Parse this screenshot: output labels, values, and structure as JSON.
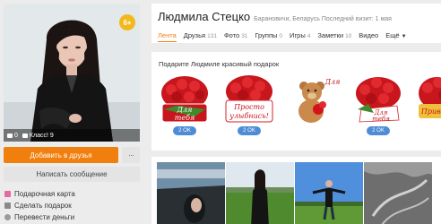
{
  "profile": {
    "name": "Людмила Стецко",
    "meta": "Барановичи, Беларусь  Последний визит: 1 мая",
    "age_badge": "6+"
  },
  "avatar": {
    "comments_count": "0",
    "klass_label": "Класс! 9"
  },
  "actions": {
    "add_friend": "Добавить в друзья",
    "more": "···",
    "write_message": "Написать сообщение"
  },
  "side_links": [
    {
      "label": "Подарочная карта",
      "icon": "gift-card-icon"
    },
    {
      "label": "Сделать подарок",
      "icon": "gift-icon"
    },
    {
      "label": "Перевести деньги",
      "icon": "money-icon"
    }
  ],
  "tabs": [
    {
      "label": "Лента",
      "count": ""
    },
    {
      "label": "Друзья",
      "count": "131"
    },
    {
      "label": "Фото",
      "count": "31"
    },
    {
      "label": "Группы",
      "count": "0"
    },
    {
      "label": "Игры",
      "count": "4"
    },
    {
      "label": "Заметки",
      "count": "10"
    },
    {
      "label": "Видео",
      "count": ""
    },
    {
      "label": "Ещё",
      "count": ""
    }
  ],
  "gifts": {
    "title": "Подарите Людмиле красивый подарок",
    "items": [
      {
        "price": "2 OK",
        "caption_lines": [
          "Для",
          "тебя"
        ]
      },
      {
        "price": "2 OK",
        "caption_lines": [
          "Просто",
          "улыбнись!"
        ]
      },
      {
        "price": "",
        "caption_lines": [
          "Для"
        ]
      },
      {
        "price": "2 OK",
        "caption_lines": [
          "Для",
          "тебя"
        ]
      },
      {
        "price": "",
        "caption_lines": [
          "Привет"
        ]
      }
    ]
  },
  "colors": {
    "accent": "#f07f0e",
    "price_blue": "#4d8cd6",
    "badge_yellow": "#f2b91e"
  }
}
